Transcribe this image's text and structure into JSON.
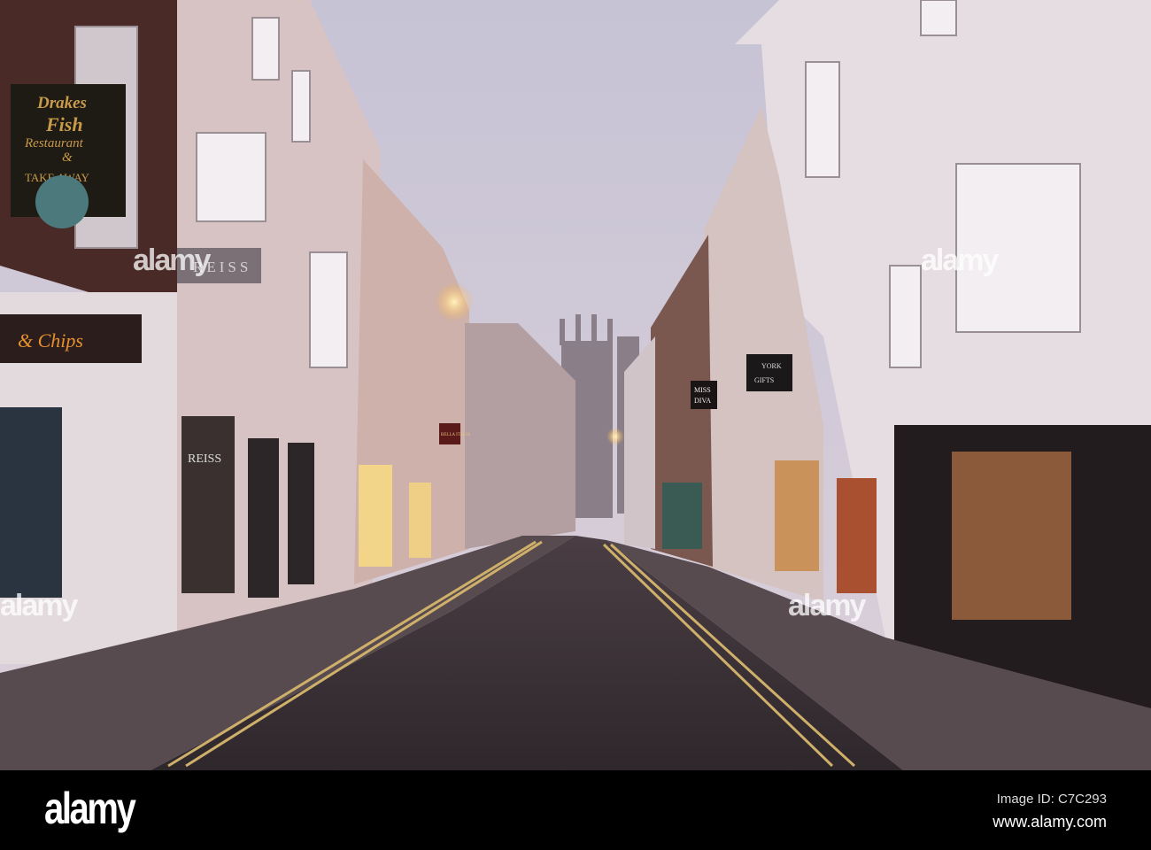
{
  "scene": {
    "description_signs": {
      "drakes_sign": [
        "Drakes",
        "Fish",
        "Restaurant",
        "&",
        "TAKE AWAY"
      ],
      "chips_sign": "& Chips",
      "reiss_sign": "REISS",
      "reiss_window": "REISS",
      "bella_italia": "BELLA ITALIA",
      "miss_diva": [
        "MISS",
        "DIVA"
      ],
      "york_gifts": [
        "YORK",
        "GIFTS"
      ]
    },
    "colors": {
      "sky_top": "#c9c6d6",
      "sky_bottom": "#d9cfd9",
      "road": "#3a3236",
      "pavement": "#5a5055",
      "lamp": "#ffd27a"
    }
  },
  "watermark": {
    "mark": "alamy",
    "logo": "alamy",
    "image_id": "Image ID: C7C293",
    "url": "www.alamy.com"
  }
}
